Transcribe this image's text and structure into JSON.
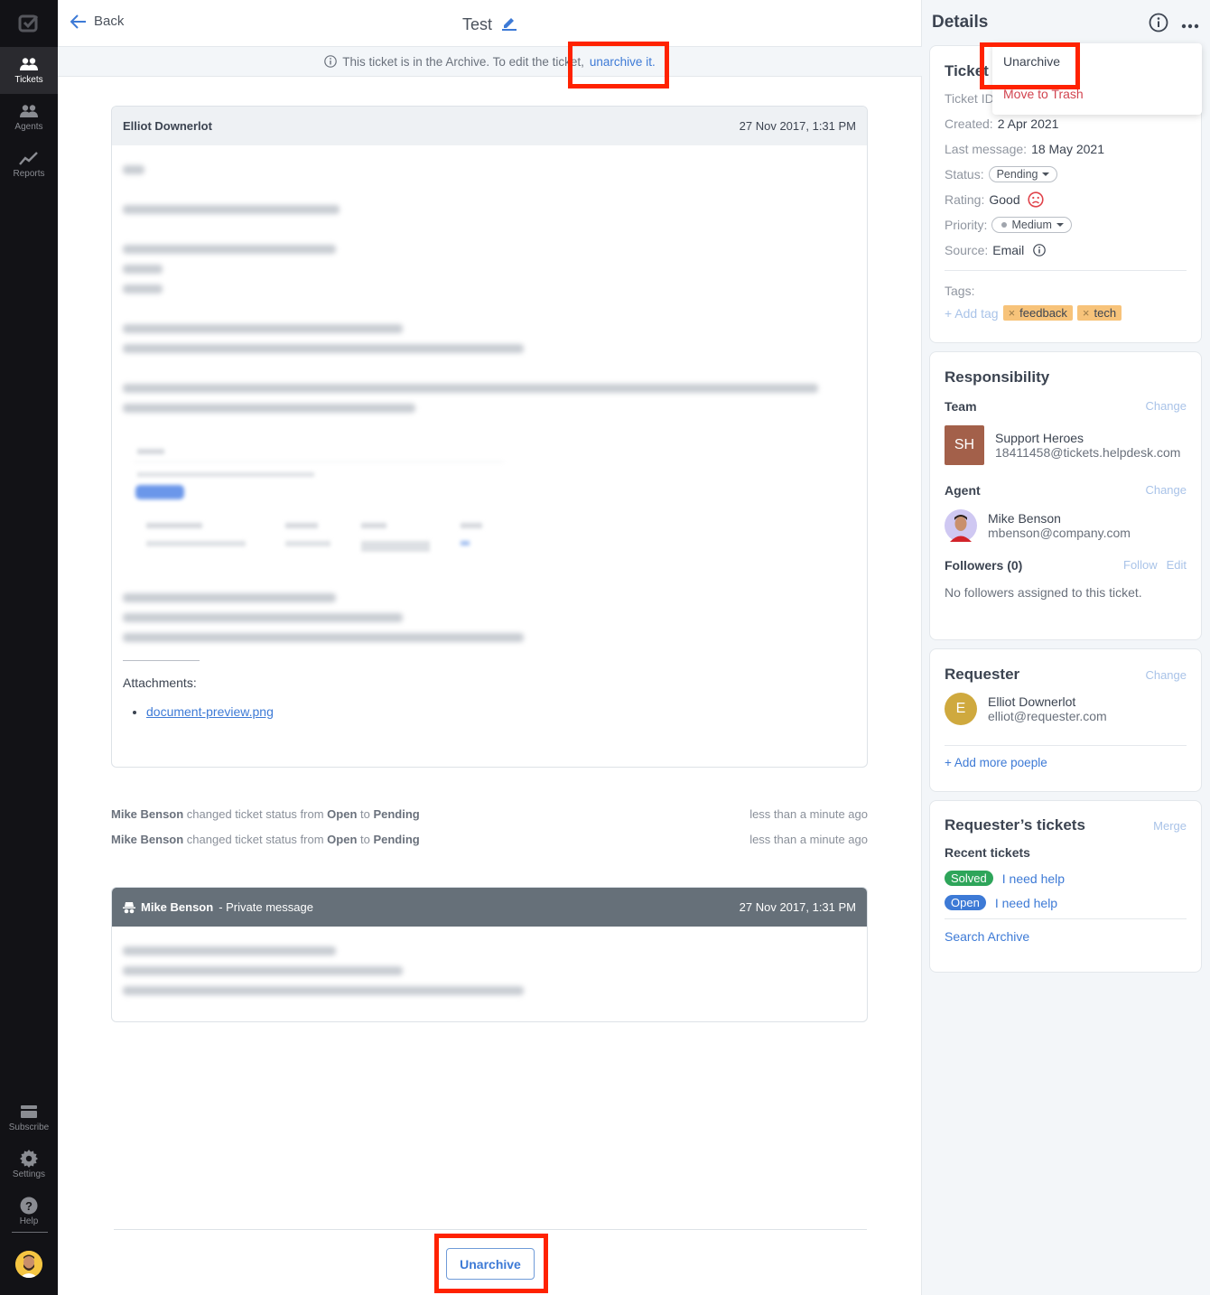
{
  "sidebar": {
    "items": [
      {
        "label": "Tickets",
        "icon": "people-icon",
        "active": true
      },
      {
        "label": "Agents",
        "icon": "people-icon",
        "active": false
      },
      {
        "label": "Reports",
        "icon": "chart-line-icon",
        "active": false
      }
    ],
    "bottom_items": [
      {
        "label": "Subscribe",
        "icon": "card-icon"
      },
      {
        "label": "Settings",
        "icon": "gear-icon"
      },
      {
        "label": "Help",
        "icon": "help-icon"
      }
    ]
  },
  "header": {
    "back_label": "Back",
    "title": "Test"
  },
  "archive_notice": {
    "text": "This ticket is in the Archive. To edit the ticket,",
    "link": "unarchive it."
  },
  "messages": [
    {
      "author": "Elliot Downerlot",
      "timestamp": "27 Nov 2017, 1:31 PM",
      "attachments_label": "Attachments:",
      "attachments": [
        "document-preview.png"
      ]
    },
    {
      "author": "Mike Benson",
      "suffix": " - Private message",
      "timestamp": "27 Nov 2017, 1:31 PM"
    }
  ],
  "events": [
    {
      "actor": "Mike Benson",
      "text": " changed ticket status from ",
      "from": "Open",
      "to_word": " to ",
      "to": "Pending",
      "time": "less than a minute ago"
    },
    {
      "actor": "Mike Benson",
      "text": " changed ticket status from ",
      "from": "Open",
      "to_word": " to ",
      "to": "Pending",
      "time": "less than a minute ago"
    }
  ],
  "footer": {
    "unarchive_label": "Unarchive"
  },
  "details": {
    "title": "Details",
    "menu": {
      "unarchive": "Unarchive",
      "trash": "Move to Trash"
    },
    "ticket_info": {
      "heading": "Ticket i",
      "ticket_id_label": "Ticket ID",
      "created_label": "Created:",
      "created": "2 Apr 2021",
      "last_message_label": "Last message:",
      "last_message": "18 May 2021",
      "status_label": "Status:",
      "status": "Pending",
      "rating_label": "Rating:",
      "rating": "Good",
      "priority_label": "Priority:",
      "priority": "Medium",
      "source_label": "Source:",
      "source": "Email",
      "tags_label": "Tags:",
      "add_tag": "+ Add tag",
      "tags": [
        "feedback",
        "tech"
      ]
    },
    "responsibility": {
      "heading": "Responsibility",
      "team_label": "Team",
      "change": "Change",
      "team_initials": "SH",
      "team_name": "Support Heroes",
      "team_email": "18411458@tickets.helpdesk.com",
      "agent_label": "Agent",
      "agent_name": "Mike Benson",
      "agent_email": "mbenson@company.com",
      "followers_label": "Followers (0)",
      "follow": "Follow",
      "edit": "Edit",
      "no_followers": "No followers assigned to this ticket."
    },
    "requester": {
      "heading": "Requester",
      "change": "Change",
      "initial": "E",
      "name": "Elliot Downerlot",
      "email": "elliot@requester.com",
      "add_more": "+ Add more poeple"
    },
    "requester_tickets": {
      "heading": "Requester’s tickets",
      "merge": "Merge",
      "recent_label": "Recent tickets",
      "tickets": [
        {
          "status": "Solved",
          "title": "I need help",
          "color": "#2ea55a"
        },
        {
          "status": "Open",
          "title": "I need help",
          "color": "#3d7ad6"
        }
      ],
      "search_archive": "Search Archive"
    }
  }
}
